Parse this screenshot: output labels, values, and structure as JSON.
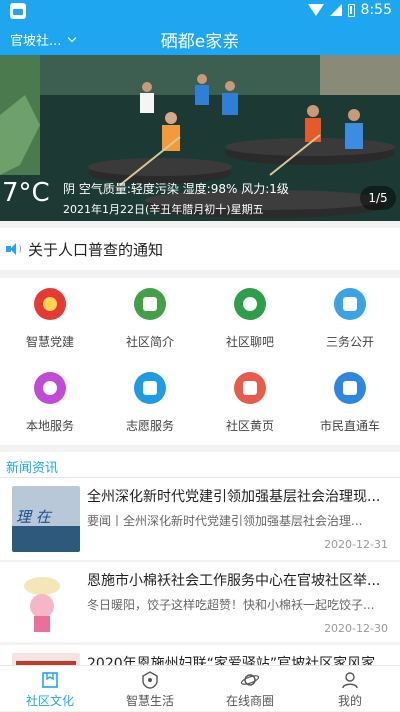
{
  "status_bar": {
    "time": "8:55"
  },
  "header": {
    "location": "官坡社...",
    "title": "硒都e家亲"
  },
  "banner": {
    "temperature": "7°C",
    "weather_line": "阴 空气质量:轻度污染 湿度:98% 风力:1级",
    "date_line": "2021年1月22日(辛丑年腊月初十)星期五",
    "pager": "1/5"
  },
  "notice": {
    "text": "关于人口普查的通知"
  },
  "grid": {
    "items": [
      {
        "label": "智慧党建",
        "color": "#e53935",
        "icon": "party-emblem-icon"
      },
      {
        "label": "社区简介",
        "color": "#43a047",
        "icon": "home-icon"
      },
      {
        "label": "社区聊吧",
        "color": "#2e9e4a",
        "icon": "chat-icon"
      },
      {
        "label": "三务公开",
        "color": "#3aa3e8",
        "icon": "calendar-icon"
      },
      {
        "label": "本地服务",
        "color": "#c14ad6",
        "icon": "hand-heart-icon"
      },
      {
        "label": "志愿服务",
        "color": "#1e9be6",
        "icon": "anchor-icon"
      },
      {
        "label": "社区黄页",
        "color": "#ea5a4a",
        "icon": "phone-book-icon"
      },
      {
        "label": "市民直通车",
        "color": "#2f86e0",
        "icon": "bus-icon"
      }
    ]
  },
  "news": {
    "header": "新闻资讯",
    "items": [
      {
        "title": "全州深化新时代党建引领加强基层社会治理现...",
        "summary": "要闻丨全州深化新时代党建引领加强基层社会治理...",
        "date": "2020-12-31"
      },
      {
        "title": "恩施市小棉袄社会工作服务中心在官坡社区举...",
        "summary": "冬日暖阳，饺子这样吃超赞！快和小棉袄一起吃饺子...",
        "date": "2020-12-30"
      },
      {
        "title": "2020年恩施州妇联“家爱驿站”官坡社区家风家...",
        "summary": "",
        "date": ""
      }
    ]
  },
  "tabbar": {
    "items": [
      {
        "label": "社区文化",
        "active": true
      },
      {
        "label": "智慧生活",
        "active": false
      },
      {
        "label": "在线商圈",
        "active": false
      },
      {
        "label": "我的",
        "active": false
      }
    ]
  },
  "colors": {
    "accent": "#1ea7f0"
  }
}
